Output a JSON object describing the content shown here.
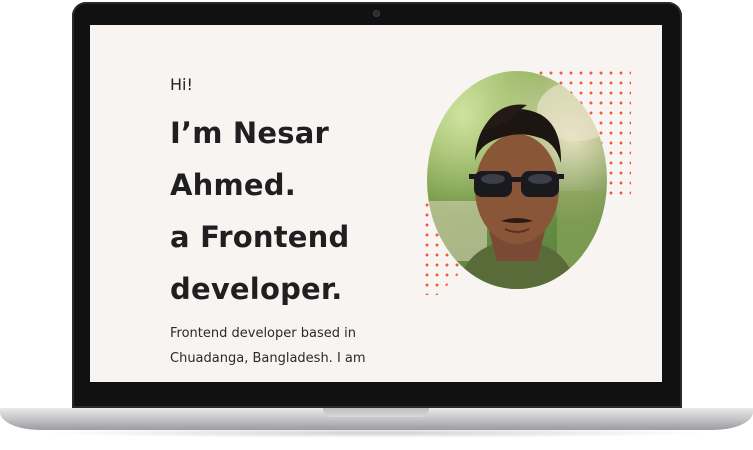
{
  "hero": {
    "greeting": "Hi!",
    "headline_lines": [
      "I’m Nesar",
      "Ahmed.",
      "a Frontend",
      "developer."
    ],
    "bio_lines": [
      "Frontend developer based in",
      "Chuadanga, Bangladesh. I am"
    ]
  },
  "colors": {
    "accent": "#ef5a3b",
    "screen_background": "#f8f4f1",
    "text": "#1f1f22"
  },
  "icons": {
    "webcam": "camera-icon"
  }
}
